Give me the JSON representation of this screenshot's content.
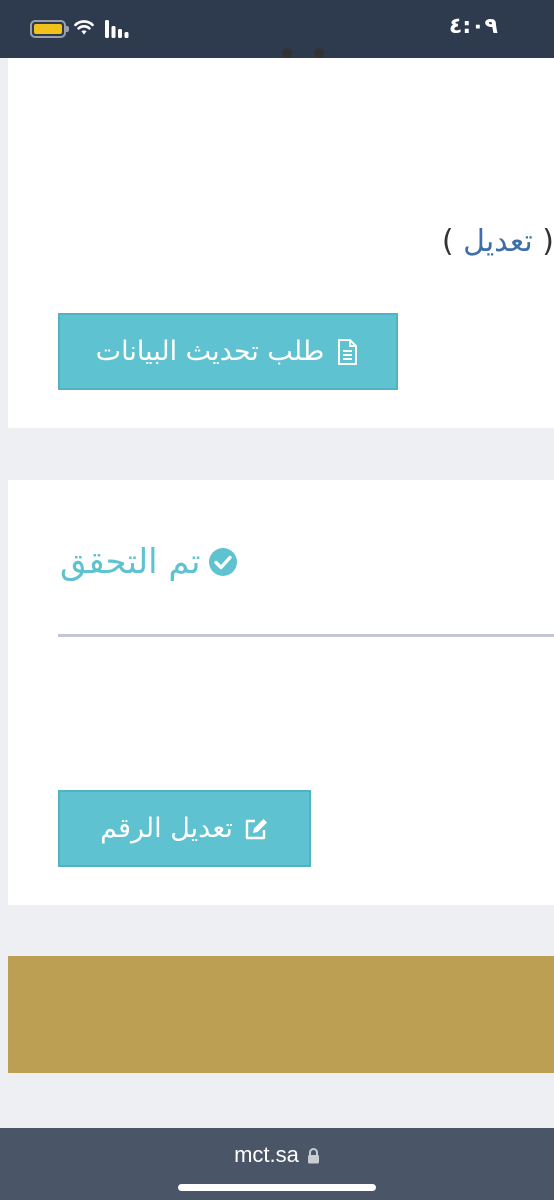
{
  "status_bar": {
    "time": "٤:٠٩",
    "battery_icon": "battery-icon",
    "wifi_icon": "wifi-icon",
    "signal_icon": "cellular-signal-icon",
    "battery_color": "#f2c21b"
  },
  "profile_card": {
    "edit_open_paren": "(",
    "edit_link": "تعديل",
    "edit_close_paren": ")",
    "update_button": {
      "label": "طلب تحديث البيانات",
      "icon": "document-icon"
    }
  },
  "phone_card": {
    "verified_label": "تم التحقق",
    "verified_icon": "check-circle-icon",
    "edit_number_button": {
      "label": "تعديل الرقم",
      "icon": "edit-pencil-icon"
    }
  },
  "colors": {
    "accent_teal": "#5ec2d0",
    "link_blue": "#3f6fa8",
    "gold": "#bd9f53",
    "status_bar_bg": "#2e3a4e",
    "browser_bar_bg": "#4a5568"
  },
  "browser_bar": {
    "url": "mct.sa",
    "lock_icon": "lock-icon"
  }
}
